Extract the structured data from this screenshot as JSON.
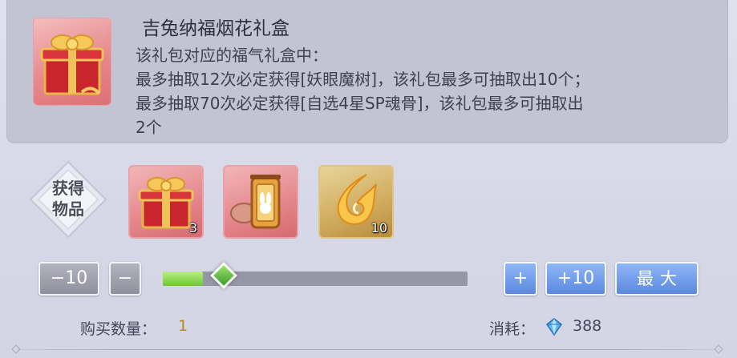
{
  "gift": {
    "title": "吉兔纳福烟花礼盒",
    "description": [
      "该礼包对应的福气礼盒中：",
      "最多抽取12次必定获得[妖眼魔树]，该礼包最多可抽取出10个；",
      "最多抽取70次必定获得[自选4星SP魂骨]，该礼包最多可抽取出",
      "2个"
    ]
  },
  "obtained": {
    "badge_line1": "获得",
    "badge_line2": "物品",
    "items": [
      {
        "icon": "red-gift-box-icon",
        "count": "3"
      },
      {
        "icon": "rabbit-lantern-box-icon",
        "count": ""
      },
      {
        "icon": "golden-flame-spirit-icon",
        "count": "10"
      }
    ]
  },
  "controls": {
    "minus10_label": "−10",
    "minus_label": "−",
    "plus_label": "+",
    "plus10_label": "+10",
    "max_label": "最大",
    "slider_value_fraction": 0.1
  },
  "footer": {
    "quantity_label": "购买数量：",
    "quantity_value": "1",
    "cost_label": "消耗：",
    "cost_value": "388",
    "cost_icon": "diamond-currency-icon"
  },
  "colors": {
    "quantity_value": "#b8861f",
    "slider_fill": "#6dc53b",
    "blue_button": "#5c89e0"
  }
}
